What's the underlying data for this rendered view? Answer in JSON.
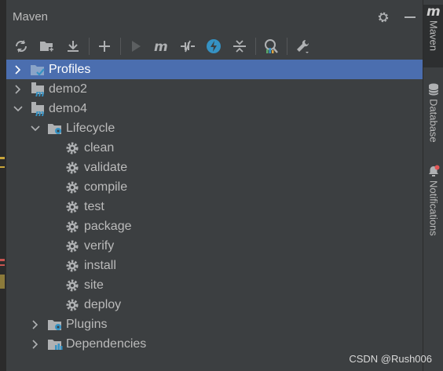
{
  "panel": {
    "title": "Maven"
  },
  "tree": {
    "profiles": "Profiles",
    "demo2": "demo2",
    "demo4": "demo4",
    "lifecycle": "Lifecycle",
    "phases": [
      "clean",
      "validate",
      "compile",
      "test",
      "package",
      "verify",
      "install",
      "site",
      "deploy"
    ],
    "plugins": "Plugins",
    "dependencies": "Dependencies"
  },
  "right_bar": {
    "maven_label": "Maven",
    "database_label": "Database",
    "notifications_label": "Notifications"
  },
  "toolbar_icons": [
    "reload-icon",
    "add-maven-project-icon",
    "download-icon",
    "add-icon",
    "run-icon",
    "maven-goal-icon",
    "toggle-offline-icon",
    "skip-tests-icon",
    "collapse-all-icon",
    "analyze-dependencies-icon",
    "settings-wrench-icon"
  ],
  "colors": {
    "selection": "#4b6eaf",
    "panel_bg": "#3c3f41",
    "accent_blue": "#3592c4"
  },
  "watermark": "CSDN @Rush006"
}
